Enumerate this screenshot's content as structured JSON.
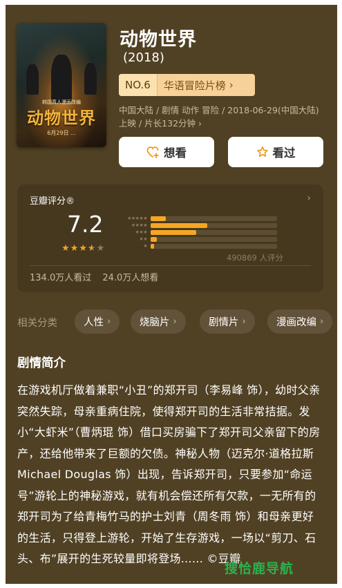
{
  "movie": {
    "title": "动物世界",
    "year": "(2018)",
    "rank_no": "NO.6",
    "rank_name": "华语冒险片榜",
    "meta": "中国大陆 / 剧情 动作 冒险 / 2018-06-29(中国大陆) 上映 / 片长132分钟",
    "want_label": "想看",
    "seen_label": "看过",
    "poster": {
      "sub": "韩国真人漫画改编",
      "title": "动物世界",
      "bottom": "6月29日 ..."
    }
  },
  "rating": {
    "label": "豆瓣评分®",
    "score": "7.2",
    "stars_value": 3.5,
    "distribution": [
      {
        "stars": "★★★★★",
        "percent": 12
      },
      {
        "stars": "★★★★",
        "percent": 45
      },
      {
        "stars": "★★★",
        "percent": 36
      },
      {
        "stars": "★★",
        "percent": 5
      },
      {
        "stars": "★",
        "percent": 3
      }
    ],
    "votes": "490869 人评分",
    "watched": "134.0万人看过",
    "want": "24.0万人想看"
  },
  "categories": {
    "label": "相关分类",
    "items": [
      "人性",
      "烧脑片",
      "剧情片",
      "漫画改编"
    ]
  },
  "synopsis": {
    "title": "剧情简介",
    "text": "在游戏机厅做着兼职“小丑”的郑开司（李易峰 饰），幼时父亲突然失踪，母亲重病住院，使得郑开司的生活非常拮据。发小“大虾米”（曹炳琨 饰）借口买房骗下了郑开司父亲留下的房产，还给他带来了巨额的欠债。神秘人物（迈克尔·道格拉斯 Michael Douglas 饰）出现，告诉郑开司，只要参加“命运号”游轮上的神秘游戏，就有机会偿还所有欠款，一无所有的郑开司为了给青梅竹马的护士刘青（周冬雨 饰）和母亲更好的生活，只得登上游轮，开始了生存游戏，一场以“剪刀、石头、布”展开的生死较量即将登场...... ©豆瓣"
  },
  "watermark": "搜恰鹿导航",
  "colors": {
    "background": "#514124",
    "accent": "#f5a623",
    "rank_badge": "#f6d29a"
  }
}
